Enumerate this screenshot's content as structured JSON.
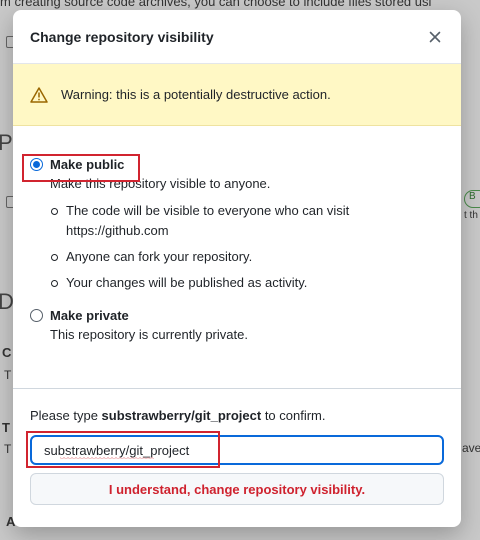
{
  "modal": {
    "title": "Change repository visibility",
    "warning": "Warning: this is a potentially destructive action.",
    "public_option": {
      "label": "Make public",
      "description": "Make this repository visible to anyone.",
      "bullets": [
        "The code will be visible to everyone who can visit https://github.com",
        "Anyone can fork your repository.",
        "Your changes will be published as activity."
      ],
      "selected": true
    },
    "private_option": {
      "label": "Make private",
      "description": "This repository is currently private.",
      "selected": false
    },
    "confirm": {
      "prefix": "Please type ",
      "repo_name": "substrawberry/git_project",
      "suffix": " to confirm.",
      "input_value": "substrawberry/git_project",
      "button_label": "I understand, change repository visibility."
    }
  },
  "background": {
    "top_text": "m creating source code archives, you can choose to include files stored usi",
    "heading_1": "Pu",
    "heading_2": "Da",
    "item_1_letter": "C",
    "item_1_text": "T",
    "item_2_letter": "T",
    "item_2_text": "T",
    "item_3_text": "A",
    "right_text": "ave",
    "right_small": "t th",
    "badge": "B"
  },
  "colors": {
    "accent": "#0969da",
    "danger": "#cf222e",
    "warning_bg": "#fff8c5",
    "highlight": "#d1242f"
  }
}
